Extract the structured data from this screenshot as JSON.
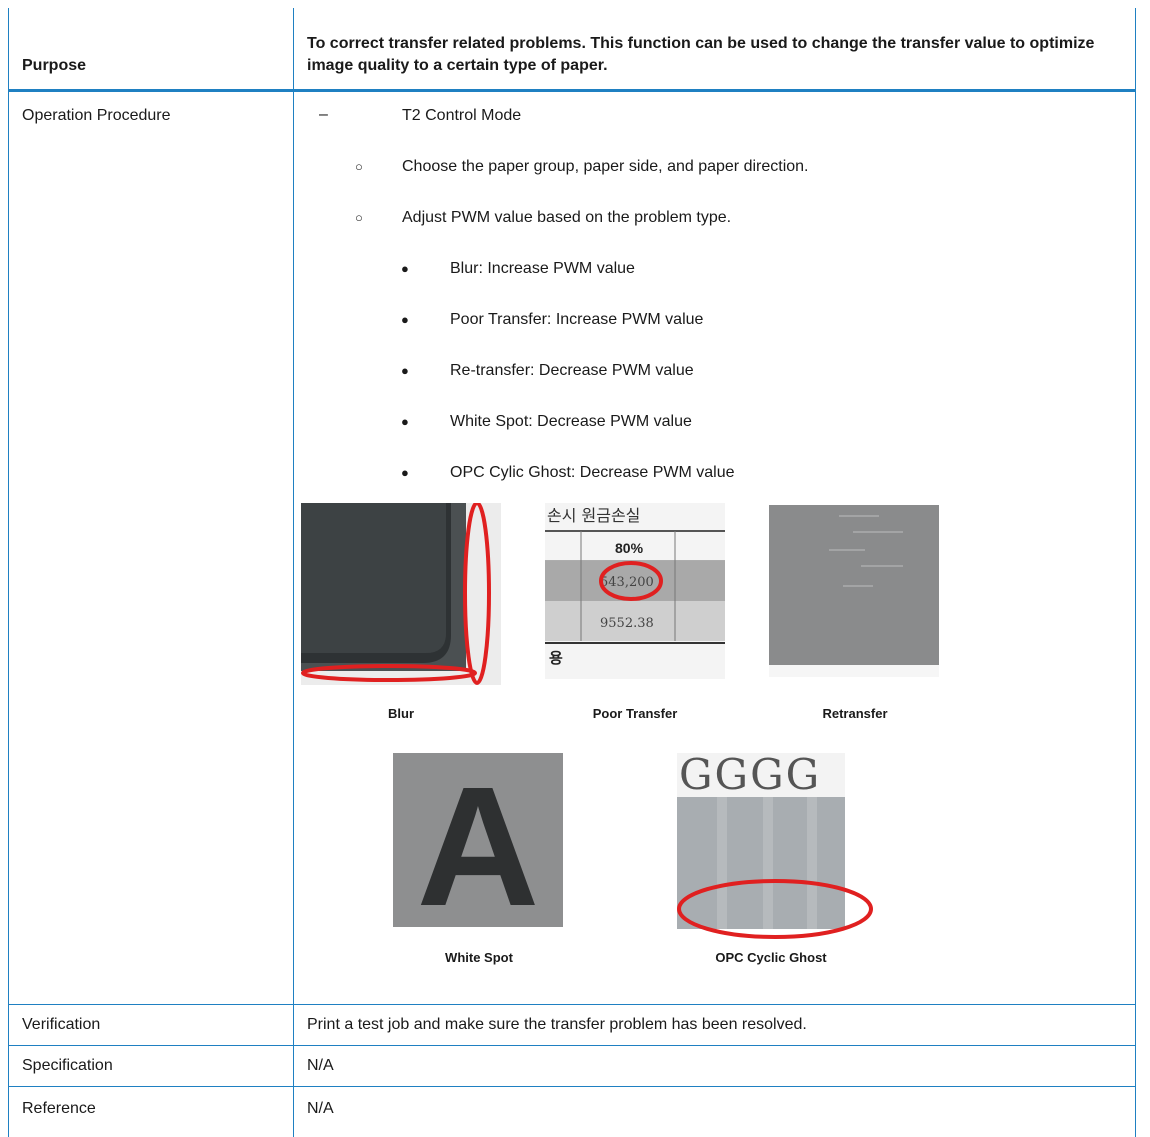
{
  "header": {
    "label": "Purpose",
    "text": "To correct transfer related problems. This function can be used to change the transfer value to optimize image quality to a certain type of paper."
  },
  "procedure": {
    "label": "Operation Procedure",
    "level1": {
      "mark": "–",
      "text": "T2 Control Mode"
    },
    "level2": [
      {
        "mark": "○",
        "text": "Choose the paper group, paper side, and paper direction."
      },
      {
        "mark": "○",
        "text": "Adjust PWM value based on the problem type."
      }
    ],
    "level3": [
      {
        "mark": "●",
        "text": "Blur: Increase PWM value"
      },
      {
        "mark": "●",
        "text": "Poor Transfer: Increase PWM value"
      },
      {
        "mark": "●",
        "text": "Re-transfer: Decrease PWM value"
      },
      {
        "mark": "●",
        "text": "White Spot: Decrease PWM value"
      },
      {
        "mark": "●",
        "text": "OPC Cylic Ghost: Decrease PWM value"
      }
    ],
    "figures": {
      "blur": {
        "caption": "Blur"
      },
      "poor_transfer": {
        "caption": "Poor Transfer",
        "korean_title": "손시 원금손실",
        "header_value": "80%",
        "cell_a": "543,200",
        "cell_b": "9552.38",
        "korean_footer": "용"
      },
      "retransfer": {
        "caption": "Retransfer"
      },
      "white_spot": {
        "caption": "White Spot",
        "letter": "A"
      },
      "opc_ghost": {
        "caption": "OPC Cyclic Ghost",
        "letters": "GGGG"
      }
    }
  },
  "verification": {
    "label": "Verification",
    "text": "Print a test job and make sure the transfer problem has been resolved."
  },
  "specification": {
    "label": "Specification",
    "text": "N/A"
  },
  "reference": {
    "label": "Reference",
    "text": "N/A"
  },
  "colors": {
    "border": "#1f80c2",
    "annotation_red": "#e02020"
  }
}
